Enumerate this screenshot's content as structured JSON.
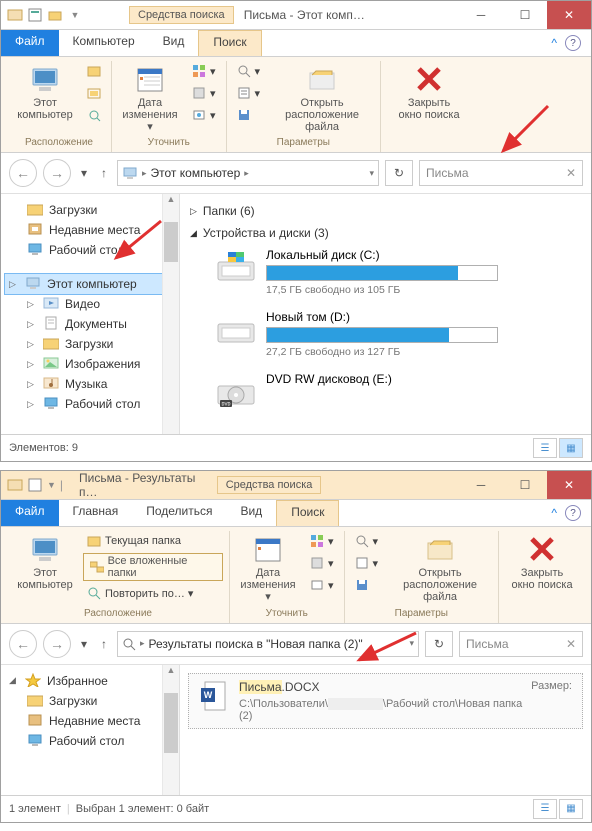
{
  "win1": {
    "toolsTab": "Средства поиска",
    "title": "Письма - Этот комп…",
    "tabs": {
      "file": "Файл",
      "computer": "Компьютер",
      "view": "Вид",
      "search": "Поиск"
    },
    "ribbon": {
      "location_group": "Расположение",
      "precise_group": "Уточнить",
      "params_group": "Параметры",
      "this_pc_l1": "Этот",
      "this_pc_l2": "компьютер",
      "date_l1": "Дата",
      "date_l2": "изменения ▾",
      "open_loc_l1": "Открыть",
      "open_loc_l2": "расположение файла",
      "close_l1": "Закрыть",
      "close_l2": "окно поиска"
    },
    "addr": {
      "crumb1": "Этот компьютер"
    },
    "search_placeholder": "Письма",
    "tree": {
      "downloads": "Загрузки",
      "recent": "Недавние места",
      "desktop": "Рабочий стол",
      "this_pc": "Этот компьютер",
      "videos": "Видео",
      "documents": "Документы",
      "downloads2": "Загрузки",
      "pictures": "Изображения",
      "music": "Музыка",
      "desktop2": "Рабочий стол"
    },
    "sections": {
      "folders": "Папки (6)",
      "devices": "Устройства и диски (3)"
    },
    "drives": {
      "c_name": "Локальный диск (C:)",
      "c_free": "17,5 ГБ свободно из 105 ГБ",
      "d_name": "Новый том (D:)",
      "d_free": "27,2 ГБ свободно из 127 ГБ",
      "dvd_name": "DVD RW дисковод (E:)"
    },
    "status": "Элементов: 9"
  },
  "win2": {
    "title": "Письма - Результаты п…",
    "toolsTab": "Средства поиска",
    "tabs": {
      "file": "Файл",
      "home": "Главная",
      "share": "Поделиться",
      "view": "Вид",
      "search": "Поиск"
    },
    "ribbon": {
      "location_group": "Расположение",
      "precise_group": "Уточнить",
      "params_group": "Параметры",
      "this_pc_l1": "Этот",
      "this_pc_l2": "компьютер",
      "cur_folder": "Текущая папка",
      "all_sub": "Все вложенные папки",
      "repeat": "Повторить по… ▾",
      "date_l1": "Дата",
      "date_l2": "изменения ▾",
      "open_loc_l1": "Открыть",
      "open_loc_l2": "расположение файла",
      "close_l1": "Закрыть",
      "close_l2": "окно поиска"
    },
    "addr_text": "Результаты поиска в \"Новая папка (2)\"",
    "search_placeholder": "Письма",
    "tree": {
      "favorites": "Избранное",
      "downloads": "Загрузки",
      "recent": "Недавние места",
      "desktop": "Рабочий стол"
    },
    "result": {
      "name_pre": "Письма",
      "name_ext": ".DOCX",
      "size_lbl": "Размер:",
      "path_pre": "С:\\Пользователи\\",
      "path_suf": "\\Рабочий стол\\Новая папка (2)"
    },
    "status": "1 элемент",
    "status2": "Выбран 1 элемент: 0 байт"
  }
}
